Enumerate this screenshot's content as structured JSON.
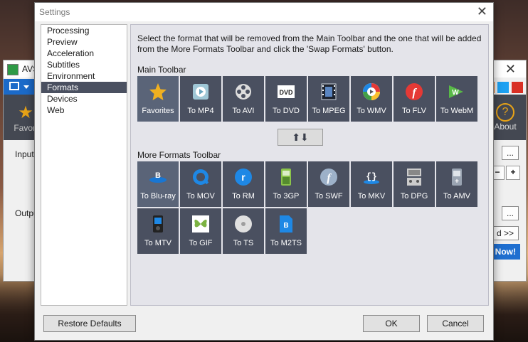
{
  "background_window": {
    "title": "AVS",
    "favorites_label": "Favori",
    "about_label": "About",
    "input_label": "Input",
    "output_label": "Output",
    "browse1": "...",
    "browse2": "...",
    "convert_more": "d >>",
    "now_button": "Now!"
  },
  "dialog": {
    "title": "Settings",
    "close_glyph": "✕",
    "nav_items": [
      "Processing",
      "Preview",
      "Acceleration",
      "Subtitles",
      "Environment",
      "Formats",
      "Devices",
      "Web"
    ],
    "selected_nav": "Formats",
    "description": "Select the format that will be removed from the Main Toolbar and the one that will be added from the More Formats Toolbar and click the 'Swap Formats' button.",
    "main_toolbar_label": "Main Toolbar",
    "more_toolbar_label": "More Formats Toolbar",
    "swap_glyph": "⬆⬇",
    "main_formats": [
      {
        "label": "Favorites",
        "icon": "star-icon",
        "selected": true
      },
      {
        "label": "To MP4",
        "icon": "mp4-icon"
      },
      {
        "label": "To AVI",
        "icon": "film-reel-icon"
      },
      {
        "label": "To DVD",
        "icon": "dvd-icon"
      },
      {
        "label": "To MPEG",
        "icon": "filmstrip-icon"
      },
      {
        "label": "To WMV",
        "icon": "wmv-icon"
      },
      {
        "label": "To FLV",
        "icon": "flash-icon"
      },
      {
        "label": "To WebM",
        "icon": "webm-icon"
      }
    ],
    "more_formats": [
      {
        "label": "To Blu-ray",
        "icon": "bluray-icon",
        "selected": true
      },
      {
        "label": "To MOV",
        "icon": "quicktime-icon"
      },
      {
        "label": "To RM",
        "icon": "realmedia-icon"
      },
      {
        "label": "To 3GP",
        "icon": "phone-icon"
      },
      {
        "label": "To SWF",
        "icon": "swf-icon"
      },
      {
        "label": "To MKV",
        "icon": "mkv-icon"
      },
      {
        "label": "To DPG",
        "icon": "ds-icon"
      },
      {
        "label": "To AMV",
        "icon": "player-icon"
      },
      {
        "label": "To MTV",
        "icon": "mtv-icon"
      },
      {
        "label": "To GIF",
        "icon": "gif-icon"
      },
      {
        "label": "To TS",
        "icon": "ts-icon"
      },
      {
        "label": "To M2TS",
        "icon": "m2ts-icon"
      }
    ],
    "restore_defaults": "Restore Defaults",
    "ok": "OK",
    "cancel": "Cancel"
  }
}
